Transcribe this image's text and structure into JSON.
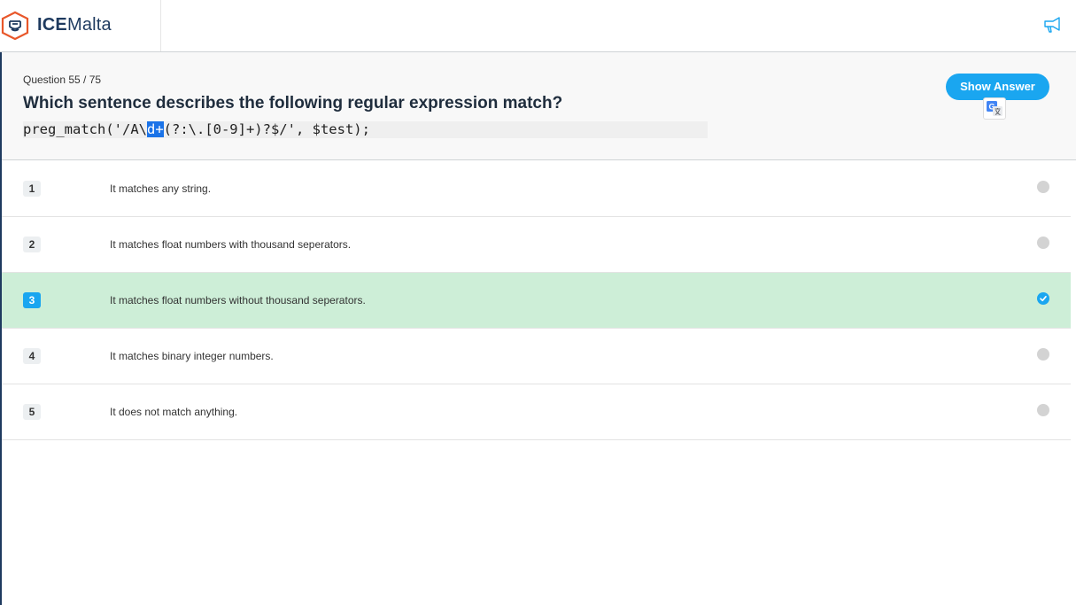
{
  "brand": {
    "bold": "ICE",
    "light": "Malta",
    "accent": "#e8572a",
    "navy": "#1e3a5f"
  },
  "question": {
    "counter": "Question 55 / 75",
    "title": "Which sentence describes the following regular expression match?",
    "code": {
      "before": "preg_match('/A\\",
      "selected": "d+",
      "after": "(?:\\.[0-9]+)?$/', $test);"
    }
  },
  "actions": {
    "show_answer": "Show Answer",
    "translate_icon": "google-translate-icon",
    "feedback_icon": "megaphone-icon"
  },
  "answers": [
    {
      "num": "1",
      "text": "It matches any string.",
      "selected": false
    },
    {
      "num": "2",
      "text": "It matches float numbers with thousand seperators.",
      "selected": false
    },
    {
      "num": "3",
      "text": "It matches float numbers without thousand seperators.",
      "selected": true
    },
    {
      "num": "4",
      "text": "It matches binary integer numbers.",
      "selected": false
    },
    {
      "num": "5",
      "text": "It does not match anything.",
      "selected": false
    }
  ],
  "colors": {
    "accent": "#1aa6f0",
    "selected_bg": "#cdeed7"
  }
}
